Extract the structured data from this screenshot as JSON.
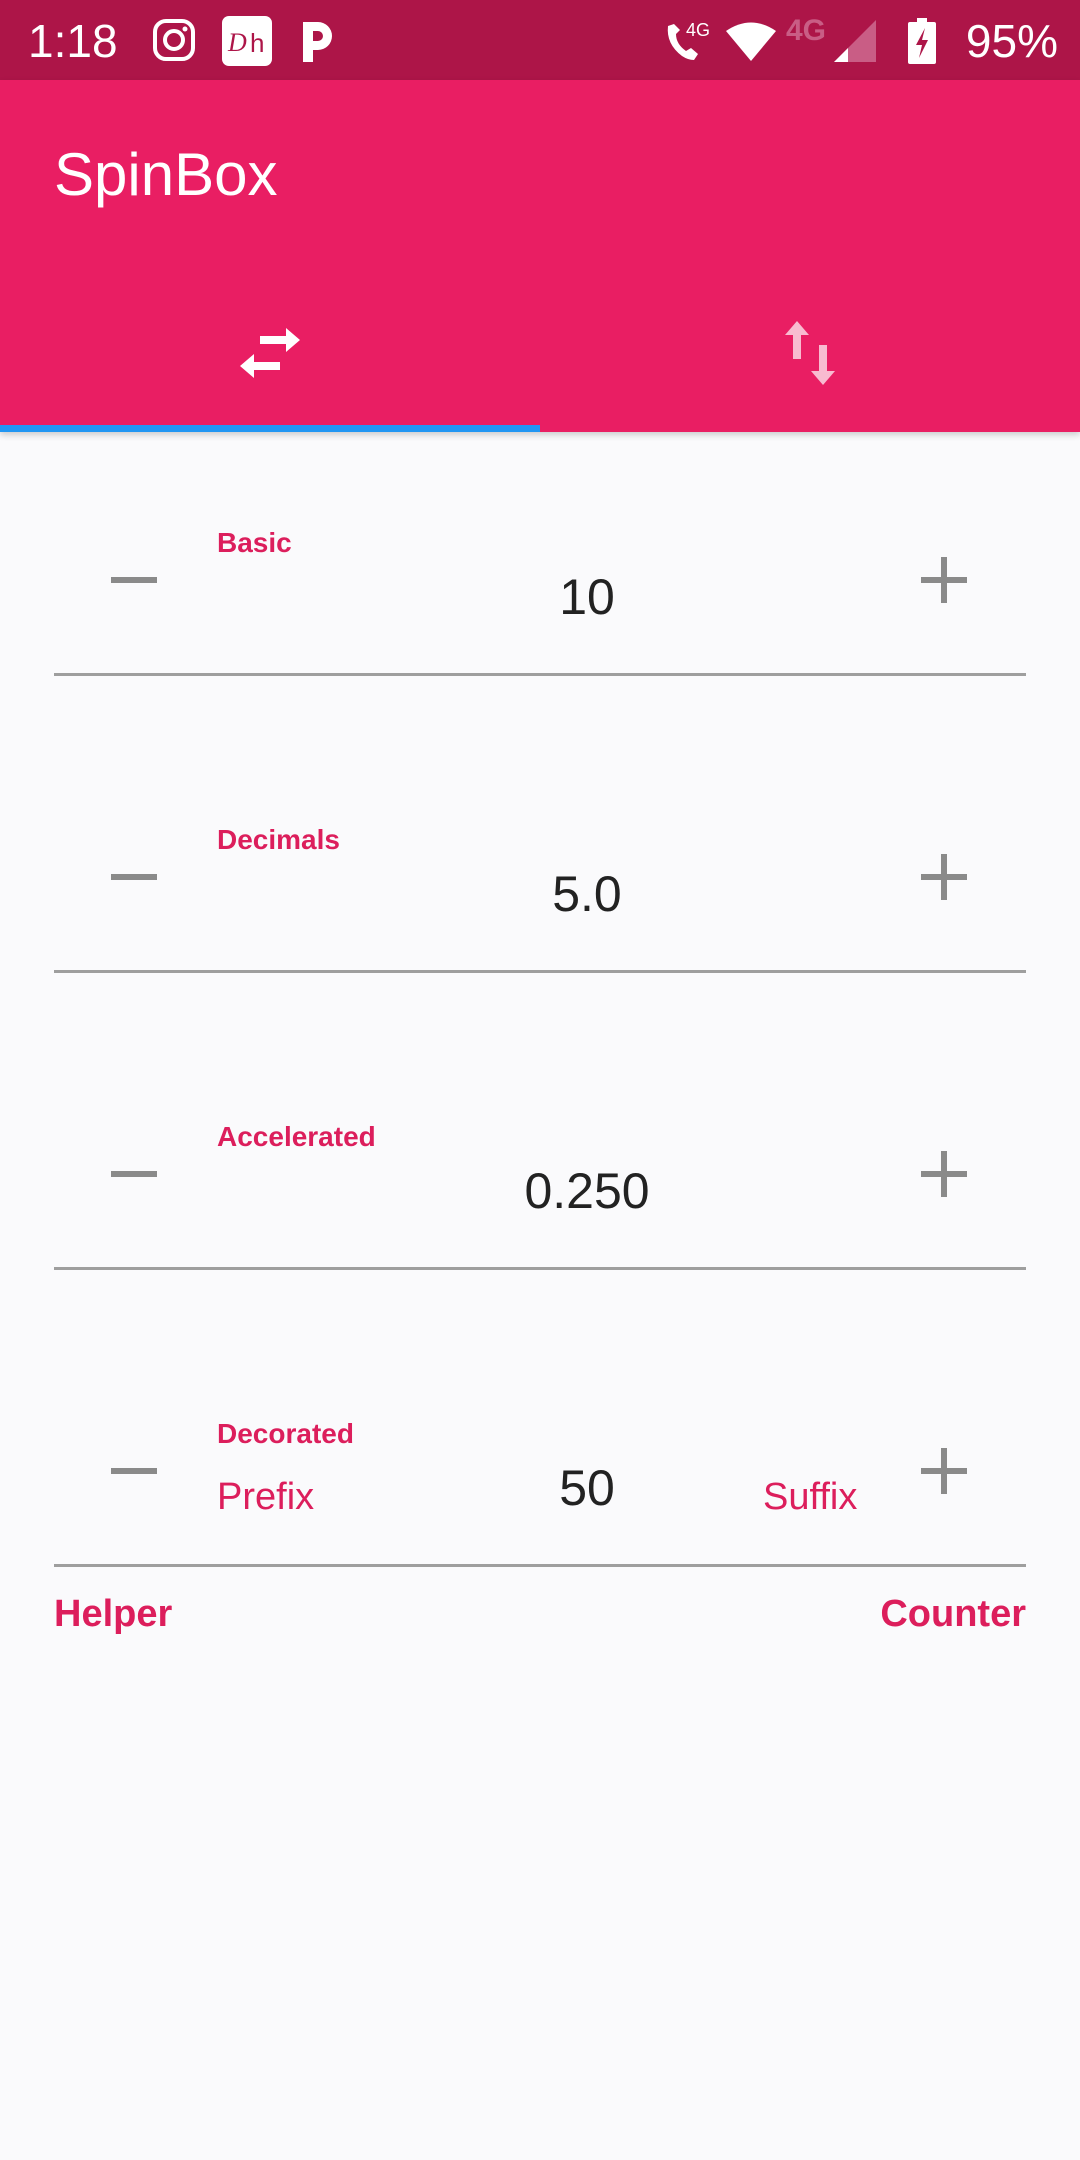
{
  "status_bar": {
    "time": "1:18",
    "notification_icons": [
      "instagram-icon",
      "disney-hotstar-icon",
      "pandora-icon"
    ],
    "system_icons": [
      "volte-call-icon",
      "wifi-icon",
      "mobile-data-4g-icon",
      "signal-icon",
      "battery-charging-icon"
    ],
    "volte_label": "4G",
    "data_label": "4G",
    "battery": "95%"
  },
  "app_bar": {
    "title": "SpinBox",
    "tabs": [
      {
        "icon": "swap-horizontal-icon",
        "selected": true
      },
      {
        "icon": "swap-vertical-icon",
        "selected": false
      }
    ]
  },
  "colors": {
    "status_bar": "#ad1548",
    "primary": "#e91e63",
    "accent_label": "#dc1e5c",
    "tab_indicator": "#2196f3",
    "background": "#fafafc"
  },
  "spinboxes": [
    {
      "label": "Basic",
      "value": "10"
    },
    {
      "label": "Decimals",
      "value": "5.0"
    },
    {
      "label": "Accelerated",
      "value": "0.250"
    },
    {
      "label": "Decorated",
      "value": "50",
      "prefix": "Prefix",
      "suffix": "Suffix",
      "helper": "Helper",
      "counter": "Counter"
    }
  ]
}
